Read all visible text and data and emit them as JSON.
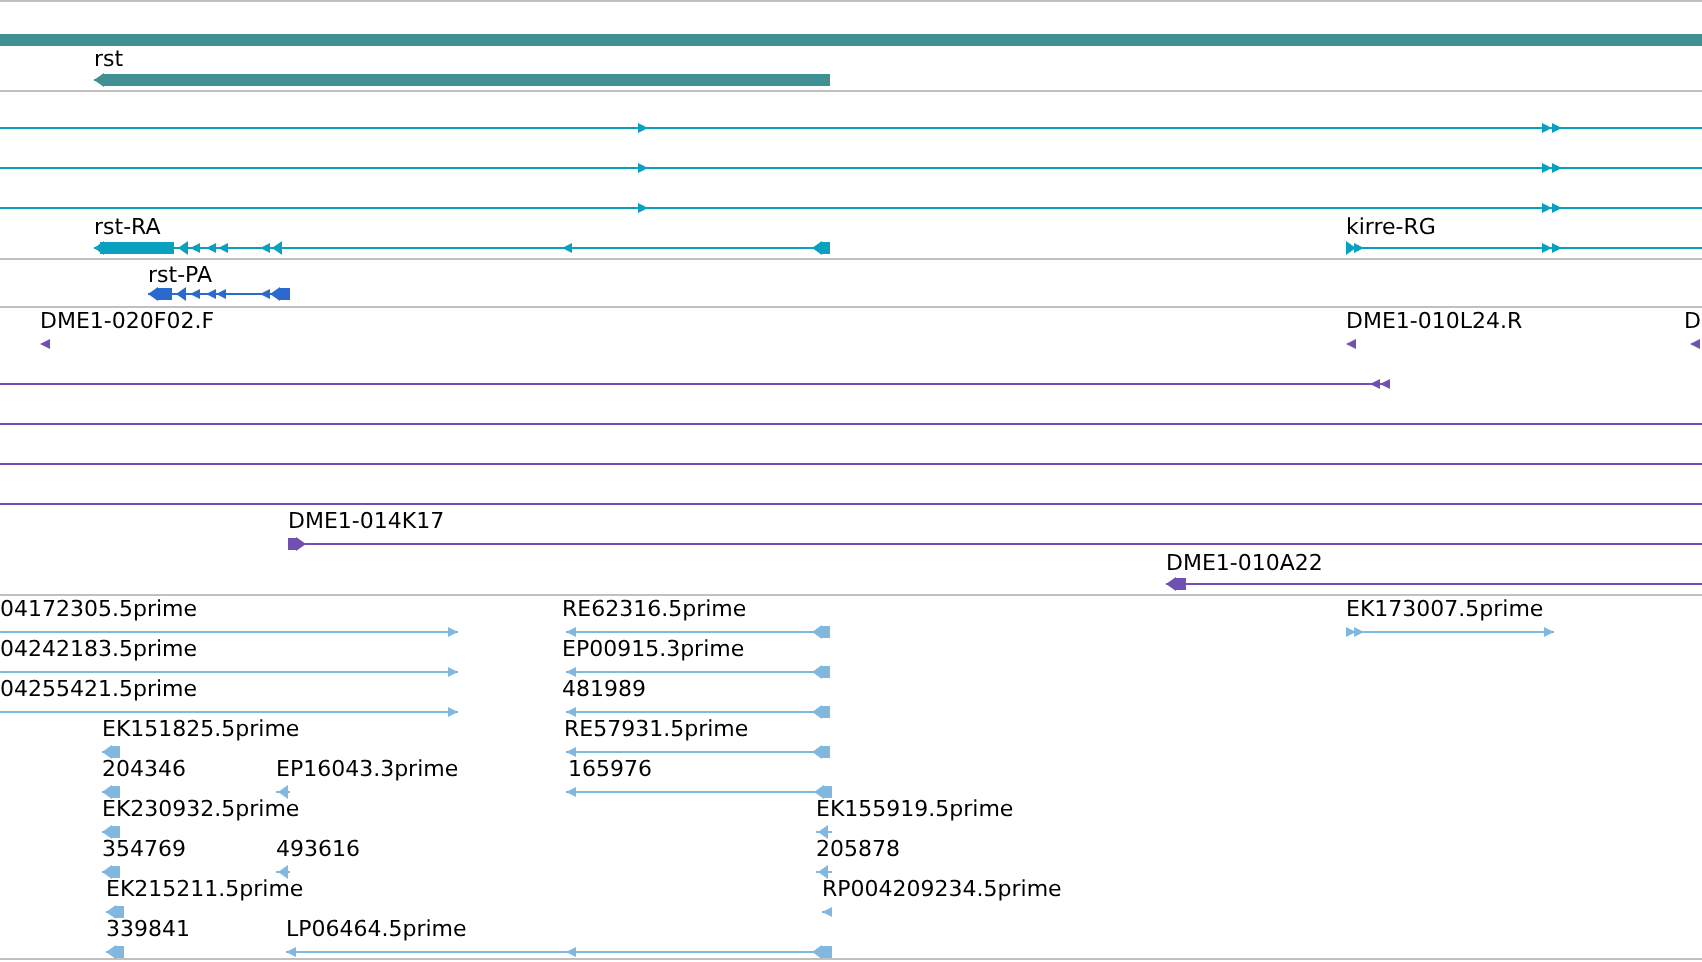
{
  "tracks": [
    {
      "kind": "summary",
      "features": [
        {
          "kind": "bar"
        },
        {
          "kind": "bar",
          "label": "rst",
          "reverse": true
        }
      ]
    },
    {
      "kind": "transcript",
      "features": [
        {
          "reverse": false
        },
        {
          "reverse": false
        },
        {
          "reverse": false
        },
        {
          "label": "rst-RA",
          "reverse": true
        },
        {
          "label": "kirre-RG",
          "reverse": false
        }
      ]
    },
    {
      "kind": "protein",
      "features": [
        {
          "label": "rst-PA",
          "reverse": true
        }
      ]
    },
    {
      "kind": "clone",
      "features": [
        {
          "kind": "marker",
          "label": "DME1-020F02.F",
          "reverse": true
        },
        {
          "kind": "marker",
          "label": "DME1-010L24.R",
          "reverse": true
        },
        {
          "kind": "marker",
          "label": "D",
          "reverse": true
        },
        {
          "kind": "line",
          "reverse": true
        },
        {
          "kind": "line"
        },
        {
          "kind": "line"
        },
        {
          "kind": "line"
        },
        {
          "kind": "line",
          "label": "DME1-014K17",
          "reverse": false
        },
        {
          "kind": "line",
          "label": "DME1-010A22",
          "reverse": true
        }
      ]
    },
    {
      "kind": "est",
      "features": [
        {
          "label": "04172305.5prime",
          "reverse": false
        },
        {
          "label": "RE62316.5prime",
          "reverse": true
        },
        {
          "label": "EK173007.5prime",
          "reverse": false
        },
        {
          "label": "04242183.5prime",
          "reverse": false
        },
        {
          "label": "EP00915.3prime",
          "reverse": true
        },
        {
          "label": "04255421.5prime",
          "reverse": false
        },
        {
          "label": "481989",
          "reverse": true
        },
        {
          "label": "EK151825.5prime",
          "reverse": true
        },
        {
          "label": "RE57931.5prime",
          "reverse": true
        },
        {
          "label": "204346",
          "reverse": true
        },
        {
          "label": "EP16043.3prime",
          "reverse": true
        },
        {
          "label": "165976",
          "reverse": true
        },
        {
          "label": "EK230932.5prime",
          "reverse": true
        },
        {
          "label": "EK155919.5prime",
          "reverse": true
        },
        {
          "label": "354769",
          "reverse": true
        },
        {
          "label": "493616",
          "reverse": true
        },
        {
          "label": "205878",
          "reverse": true
        },
        {
          "label": "EK215211.5prime",
          "reverse": true
        },
        {
          "label": "RP004209234.5prime",
          "reverse": true
        },
        {
          "label": "339841",
          "reverse": true
        },
        {
          "label": "LP06464.5prime",
          "reverse": true
        }
      ]
    }
  ]
}
